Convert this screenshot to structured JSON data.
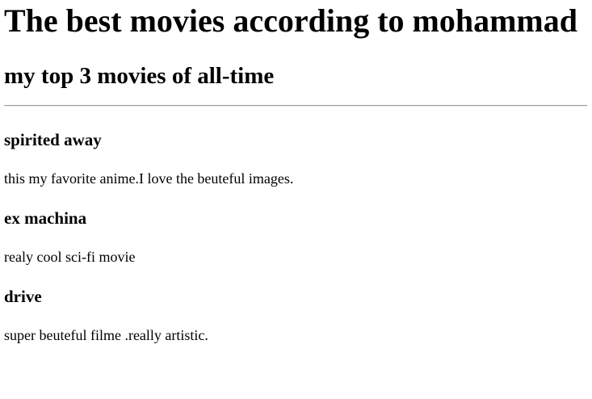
{
  "page": {
    "title": "The best movies according to mohammad",
    "subtitle": "my top 3 movies of all-time"
  },
  "movies": [
    {
      "title": "spirited away",
      "description": "this my favorite anime.I love the beuteful images."
    },
    {
      "title": "ex machina",
      "description": "realy cool sci-fi movie"
    },
    {
      "title": "drive",
      "description": "super beuteful filme .really artistic."
    }
  ]
}
